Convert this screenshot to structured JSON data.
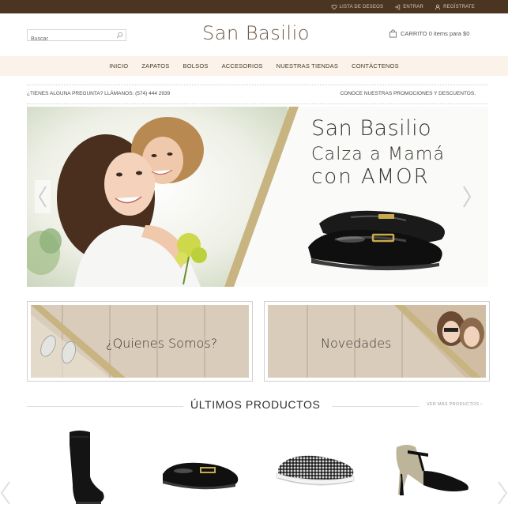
{
  "topbar": {
    "wishlist": "LISTA DE DESEOS",
    "login": "ENTRAR",
    "register": "REGÍSTRATE"
  },
  "search": {
    "placeholder": "Buscar"
  },
  "brand": {
    "logo": "San Basilio"
  },
  "cart": {
    "label": "CARRITO 0 items para $0"
  },
  "nav": {
    "items": [
      "INICIO",
      "ZAPATOS",
      "BOLSOS",
      "ACCESORIOS",
      "NUESTRAS TIENDAS",
      "CONTÁCTENOS"
    ]
  },
  "infobar": {
    "phone": "¿TIENES ALGUNA PREGUNTA? LLÁMANOS: (574) 444 2939",
    "promo": "CONOCE NUESTRAS PROMOCIONES Y DESCUENTOS."
  },
  "slider": {
    "brand": "San Basilio",
    "line1": "Calza a Mamá",
    "line2": "con AMOR"
  },
  "promos": {
    "about": "¿Quienes Somos?",
    "news": "Novedades"
  },
  "products": {
    "title": "ÚLTIMOS PRODUCTOS",
    "see_more": "VER MÁS PRODUCTOS"
  },
  "colors": {
    "topbar": "#4a3520",
    "nav_bg": "#fbf3ea",
    "gold_stripe": "#c8b480"
  },
  "icons": [
    "heart-icon",
    "login-icon",
    "user-icon",
    "search-icon",
    "bag-icon",
    "chevron-left-icon",
    "chevron-right-icon"
  ]
}
